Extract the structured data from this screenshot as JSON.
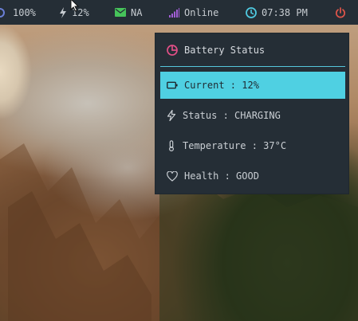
{
  "topbar": {
    "brightness": {
      "icon": "sun-icon",
      "value": "100%"
    },
    "battery": {
      "icon": "lightning-icon",
      "value": "12%"
    },
    "mail": {
      "icon": "mail-icon",
      "value": "NA"
    },
    "network": {
      "icon": "signal-icon",
      "value": "Online"
    },
    "clock": {
      "icon": "clock-icon",
      "value": "07:38 PM"
    },
    "power": {
      "icon": "power-icon"
    }
  },
  "popup": {
    "title": "Battery Status",
    "title_icon": "pie-chart-icon",
    "rows": [
      {
        "icon": "battery-icon",
        "label": "Current : 12%",
        "active": true
      },
      {
        "icon": "lightning-icon",
        "label": "Status : CHARGING",
        "active": false
      },
      {
        "icon": "thermometer-icon",
        "label": "Temperature : 37°C",
        "active": false
      },
      {
        "icon": "heart-icon",
        "label": "Health : GOOD",
        "active": false
      }
    ]
  },
  "colors": {
    "bar_bg": "#252e36",
    "accent_cyan": "#4fd0e2",
    "mail_green": "#46c45a",
    "signal_purple": "#a25fd6",
    "clock_cyan": "#4fc9e0",
    "power_red": "#e0554a",
    "title_icon_pink": "#e04f86"
  }
}
